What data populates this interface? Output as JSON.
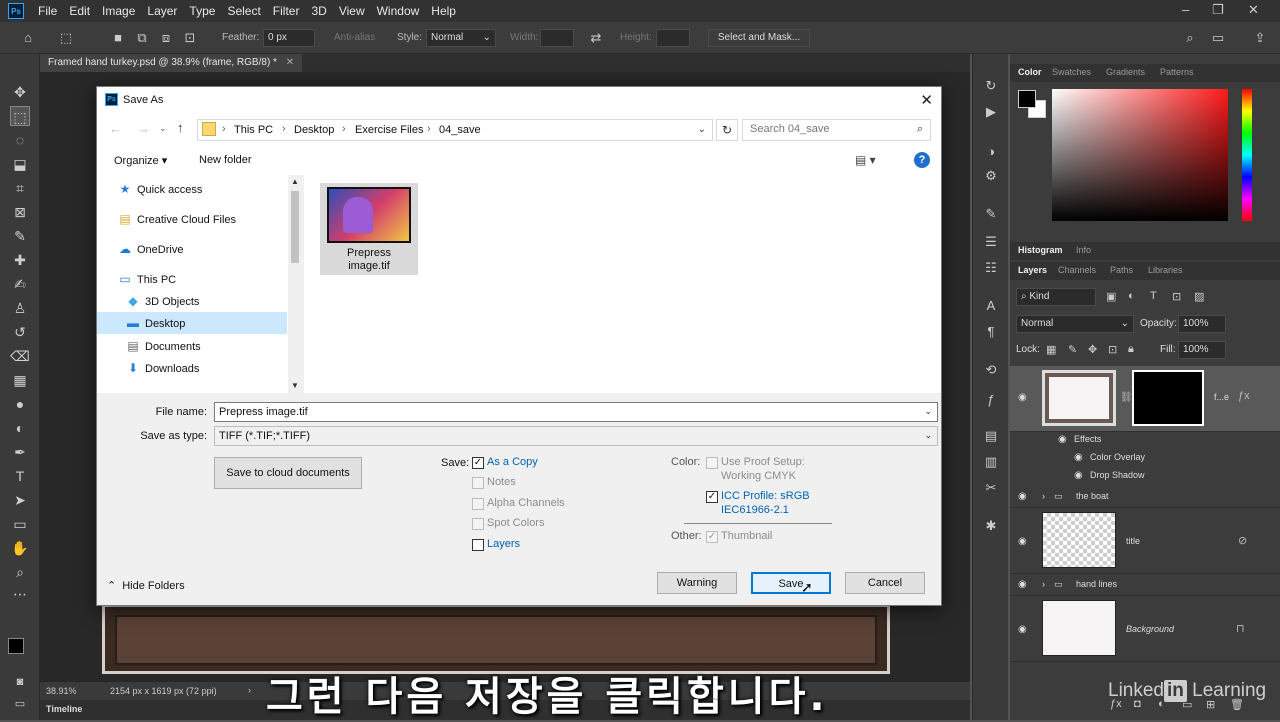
{
  "app": {
    "menu": [
      "File",
      "Edit",
      "Image",
      "Layer",
      "Type",
      "Select",
      "Filter",
      "3D",
      "View",
      "Window",
      "Help"
    ],
    "logo_text": "Ps"
  },
  "options_bar": {
    "feather_label": "Feather:",
    "feather_value": "0 px",
    "anti_alias_label": "Anti-alias",
    "style_label": "Style:",
    "style_value": "Normal",
    "width_label": "Width:",
    "height_label": "Height:",
    "select_mask_label": "Select and Mask..."
  },
  "document": {
    "tab_title": "Framed hand turkey.psd @ 38.9% (frame, RGB/8) *",
    "zoom": "38.91%",
    "dimensions": "2154 px x 1619 px (72 ppi)",
    "timeline_label": "Timeline"
  },
  "dialog": {
    "title": "Save As",
    "breadcrumb": [
      "This PC",
      "Desktop",
      "Exercise Files",
      "04_save"
    ],
    "search_placeholder": "Search 04_save",
    "organize_label": "Organize ▾",
    "new_folder_label": "New folder",
    "nav_items": [
      {
        "label": "Quick access",
        "icon": "★"
      },
      {
        "label": "Creative Cloud Files",
        "icon": "▤"
      },
      {
        "label": "OneDrive",
        "icon": "☁"
      },
      {
        "label": "This PC",
        "icon": "▭"
      },
      {
        "label": "3D Objects",
        "icon": "◆"
      },
      {
        "label": "Desktop",
        "icon": "▬"
      },
      {
        "label": "Documents",
        "icon": "▤"
      },
      {
        "label": "Downloads",
        "icon": "⬇"
      }
    ],
    "file_item": {
      "name_line1": "Prepress",
      "name_line2": "image.tif"
    },
    "file_name_label": "File name:",
    "file_name_value": "Prepress image.tif",
    "save_type_label": "Save as type:",
    "save_type_value": "TIFF (*.TIF;*.TIFF)",
    "cloud_button": "Save to cloud documents",
    "save_options_label": "Save:",
    "save_options": [
      {
        "label": "As a Copy",
        "checked": true,
        "enabled": true
      },
      {
        "label": "Notes",
        "checked": false,
        "enabled": false
      },
      {
        "label": "Alpha Channels",
        "checked": false,
        "enabled": false
      },
      {
        "label": "Spot Colors",
        "checked": false,
        "enabled": false
      },
      {
        "label": "Layers",
        "checked": false,
        "enabled": true
      }
    ],
    "color_label": "Color:",
    "proof_setup_line1": "Use Proof Setup:",
    "proof_setup_line2": "Working CMYK",
    "icc_line1": "ICC Profile:  sRGB",
    "icc_line2": "IEC61966-2.1",
    "other_label": "Other:",
    "thumbnail_label": "Thumbnail",
    "hide_folders_label": "Hide Folders",
    "warning_button": "Warning",
    "save_button": "Save",
    "cancel_button": "Cancel"
  },
  "panels": {
    "color_tabs": [
      "Color",
      "Swatches",
      "Gradients",
      "Patterns"
    ],
    "hist_tabs": [
      "Histogram",
      "Info"
    ],
    "layer_tabs": [
      "Layers",
      "Channels",
      "Paths",
      "Libraries"
    ],
    "kind_label": "Kind",
    "blend_mode": "Normal",
    "opacity_label": "Opacity:",
    "opacity_value": "100%",
    "lock_label": "Lock:",
    "fill_label": "Fill:",
    "fill_value": "100%",
    "layers": {
      "frame_name": "f...e",
      "effects_label": "Effects",
      "effect_1": "Color Overlay",
      "effect_2": "Drop Shadow",
      "boat": "the boat",
      "title": "title",
      "hand_lines": "hand lines",
      "background": "Background"
    }
  },
  "overlay": {
    "subtitle": "그런 다음 저장을 클릭합니다.",
    "brand_word": "Linked",
    "brand_in": "in",
    "brand_tail": " Learning"
  }
}
